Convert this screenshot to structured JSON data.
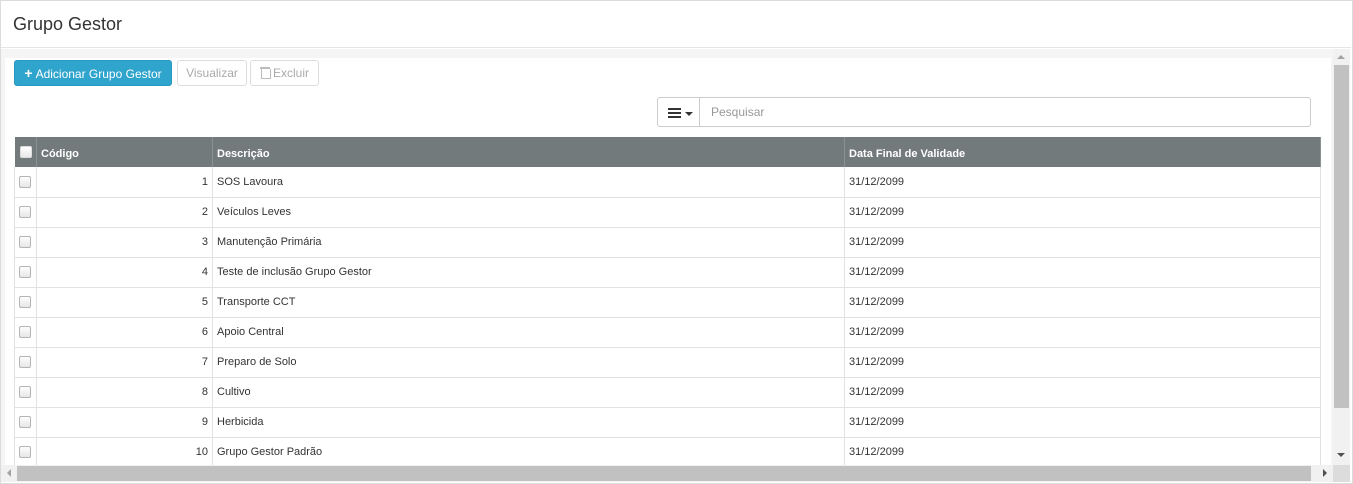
{
  "page": {
    "title": "Grupo Gestor"
  },
  "toolbar": {
    "add_label": "Adicionar Grupo Gestor",
    "view_label": "Visualizar",
    "delete_label": "Excluir"
  },
  "search": {
    "placeholder": "Pesquisar",
    "value": ""
  },
  "table": {
    "columns": [
      "Código",
      "Descrição",
      "Data Final de Validade"
    ],
    "rows": [
      {
        "code": "1",
        "description": "SOS Lavoura",
        "end_date": "31/12/2099"
      },
      {
        "code": "2",
        "description": "Veículos Leves",
        "end_date": "31/12/2099"
      },
      {
        "code": "3",
        "description": "Manutenção Primária",
        "end_date": "31/12/2099"
      },
      {
        "code": "4",
        "description": "Teste de inclusão Grupo Gestor",
        "end_date": "31/12/2099"
      },
      {
        "code": "5",
        "description": "Transporte CCT",
        "end_date": "31/12/2099"
      },
      {
        "code": "6",
        "description": "Apoio Central",
        "end_date": "31/12/2099"
      },
      {
        "code": "7",
        "description": "Preparo de Solo",
        "end_date": "31/12/2099"
      },
      {
        "code": "8",
        "description": "Cultivo",
        "end_date": "31/12/2099"
      },
      {
        "code": "9",
        "description": "Herbicida",
        "end_date": "31/12/2099"
      },
      {
        "code": "10",
        "description": "Grupo Gestor Padrão",
        "end_date": "31/12/2099"
      }
    ]
  },
  "colors": {
    "primary": "#2fa4cc",
    "table_header": "#737a7c"
  },
  "icons": {
    "add": "plus-icon",
    "delete": "trash-icon",
    "columns": "list-icon"
  }
}
